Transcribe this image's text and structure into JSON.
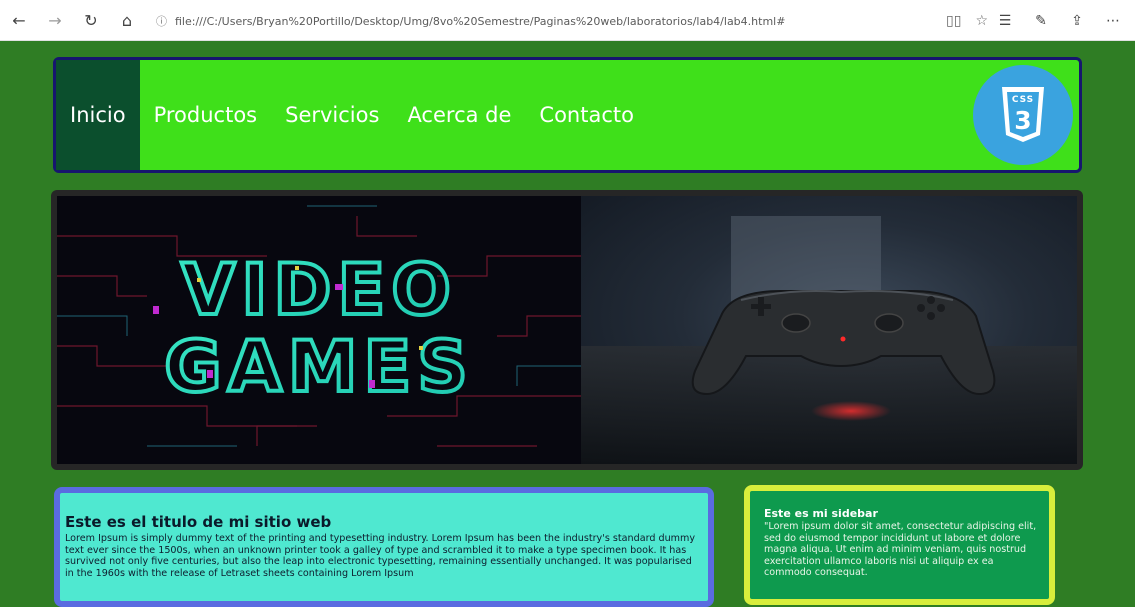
{
  "browser": {
    "url": "file:///C:/Users/Bryan%20Portillo/Desktop/Umg/8vo%20Semestre/Paginas%20web/laboratorios/lab4/lab4.html#",
    "back_icon": "arrow-left-icon",
    "forward_icon": "arrow-right-icon",
    "refresh_icon": "refresh-icon",
    "home_icon": "home-icon"
  },
  "header": {
    "menu": [
      {
        "label": "Inicio",
        "active": true
      },
      {
        "label": "Productos",
        "active": false
      },
      {
        "label": "Servicios",
        "active": false
      },
      {
        "label": "Acerca de",
        "active": false
      },
      {
        "label": "Contacto",
        "active": false
      }
    ],
    "logo_label": "CSS",
    "logo_number": "3"
  },
  "banner": {
    "left_text_line1": "VIDEO",
    "left_text_line2": "GAMES"
  },
  "main": {
    "title": "Este es el titulo de mi sitio web",
    "body": "Lorem Ipsum is simply dummy text of the printing and typesetting industry. Lorem Ipsum has been the industry's standard dummy text ever since the 1500s, when an unknown printer took a galley of type and scrambled it to make a type specimen book. It has survived not only five centuries, but also the leap into electronic typesetting, remaining essentially unchanged. It was popularised in the 1960s with the release of Letraset sheets containing Lorem Ipsum"
  },
  "sidebar": {
    "title": "Este es mi sidebar",
    "body": "\"Lorem ipsum dolor sit amet, consectetur adipiscing elit, sed do eiusmod tempor incididunt ut labore et dolore magna aliqua. Ut enim ad minim veniam, quis nostrud exercitation ullamco laboris nisi ut aliquip ex ea commodo consequat."
  },
  "colors": {
    "page_bg": "#2f7d24",
    "header_bg": "#3fe01a",
    "header_border": "#16166e",
    "menu_active_bg": "#0b4f2d",
    "main_bg": "#4fe8d0",
    "main_border": "#5a6be0",
    "sidebar_bg": "#0e9a4e",
    "sidebar_border": "#d8ee3c"
  }
}
